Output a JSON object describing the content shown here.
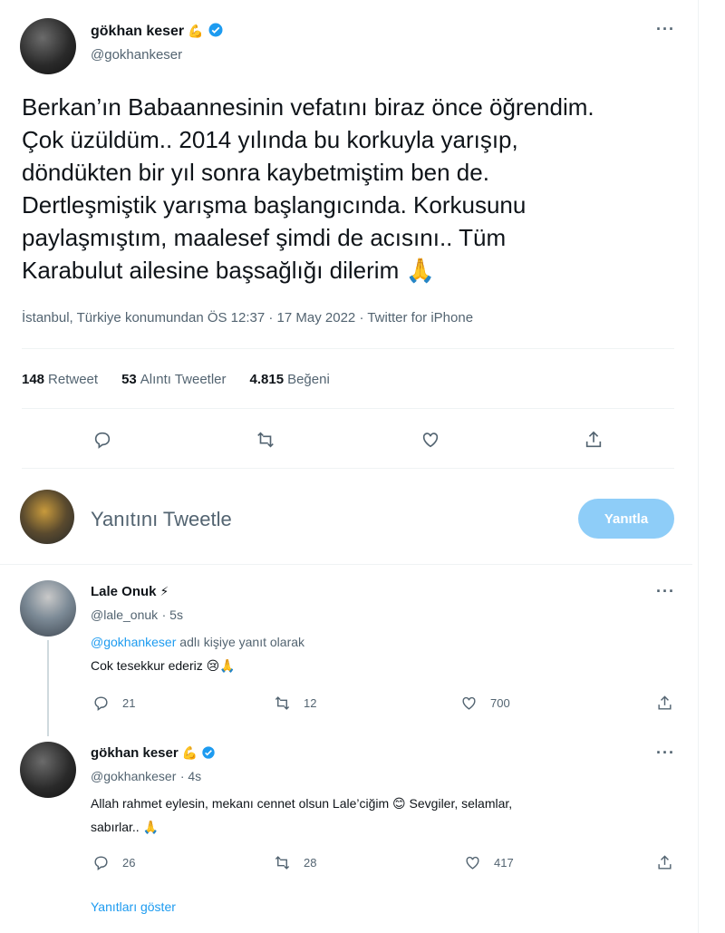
{
  "main_tweet": {
    "author_name": "gökhan keser",
    "name_emoji": "💪",
    "handle": "@gokhankeser",
    "text_lines": [
      "Berkan’ın Babaannesinin vefatını biraz önce öğrendim.",
      "Çok üzüldüm.. 2014 yılında bu korkuyla yarışıp,",
      "döndükten bir yıl sonra kaybetmiştim ben de.",
      "Dertleşmiştik yarışma başlangıcında. Korkusunu",
      "paylaşmıştım, maalesef şimdi de acısını.. Tüm",
      "Karabulut ailesine başsağlığı dilerim 🙏"
    ],
    "meta": "İstanbul, Türkiye konumundan ÖS 12:37 · 17 May 2022 · Twitter for iPhone",
    "stats": {
      "retweets_count": "148",
      "retweets_label": "Retweet",
      "quotes_count": "53",
      "quotes_label": "Alıntı Tweetler",
      "likes_count": "4.815",
      "likes_label": "Beğeni"
    }
  },
  "reply_composer": {
    "placeholder": "Yanıtını Tweetle",
    "button_label": "Yanıtla"
  },
  "replies": [
    {
      "author_name": "Lale Onuk",
      "name_emoji": "⚡",
      "handle": "@lale_onuk",
      "time": "· 5s",
      "replying_to_handle": "@gokhankeser",
      "replying_to_suffix": "adlı kişiye yanıt olarak",
      "text": "Cok tesekkur ederiz 😢🙏",
      "counts": {
        "replies": "21",
        "retweets": "12",
        "likes": "700"
      }
    },
    {
      "author_name": "gökhan keser",
      "name_emoji": "💪",
      "handle": "@gokhankeser",
      "time": "· 4s",
      "text_line1": "Allah rahmet eylesin, mekanı cennet olsun Lale’ciğim 😊 Sevgiler, selamlar,",
      "text_line2": "sabırlar.. 🙏",
      "counts": {
        "replies": "26",
        "retweets": "28",
        "likes": "417"
      },
      "show_replies": "Yanıtları göster"
    }
  ],
  "colors": {
    "accent": "#1d9bf0",
    "button_disabled": "#8ecdf8",
    "secondary_text": "#536471"
  },
  "icons": [
    "reply-icon",
    "retweet-icon",
    "like-icon",
    "share-icon",
    "verified-icon",
    "more-icon"
  ]
}
